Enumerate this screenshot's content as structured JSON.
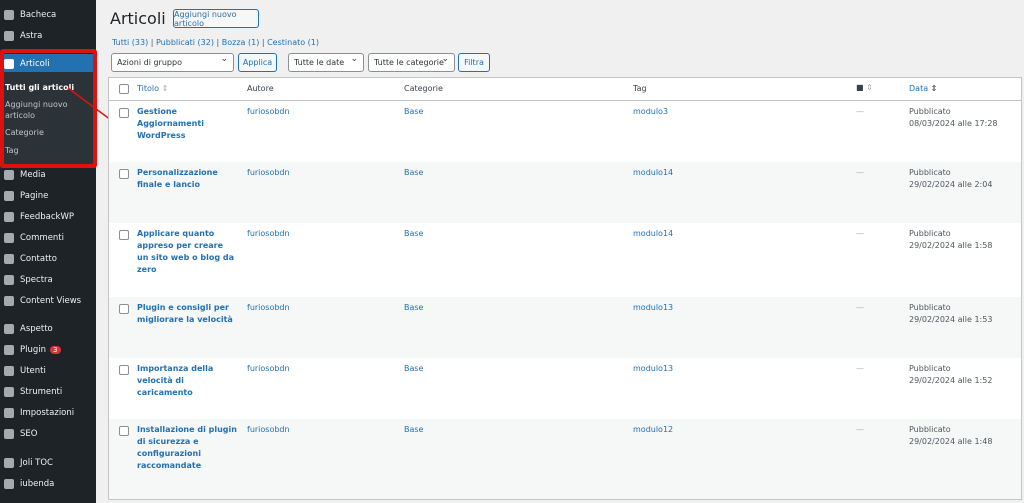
{
  "sidebar": {
    "items": [
      {
        "label": "Bacheca",
        "icon": "dashboard-icon"
      },
      {
        "label": "Astra",
        "icon": "astra-icon"
      },
      {
        "label": "Articoli",
        "icon": "pin-icon"
      },
      {
        "label": "Media",
        "icon": "media-icon"
      },
      {
        "label": "Pagine",
        "icon": "pages-icon"
      },
      {
        "label": "FeedbackWP",
        "icon": "thumbs-up-icon"
      },
      {
        "label": "Commenti",
        "icon": "comment-icon"
      },
      {
        "label": "Contatto",
        "icon": "mail-icon"
      },
      {
        "label": "Spectra",
        "icon": "spectra-icon"
      },
      {
        "label": "Content Views",
        "icon": "grid-icon"
      },
      {
        "label": "Aspetto",
        "icon": "brush-icon"
      },
      {
        "label": "Plugin",
        "icon": "plugin-icon",
        "badge": "3"
      },
      {
        "label": "Utenti",
        "icon": "user-icon"
      },
      {
        "label": "Strumenti",
        "icon": "wrench-icon"
      },
      {
        "label": "Impostazioni",
        "icon": "settings-icon"
      },
      {
        "label": "SEO",
        "icon": "seo-icon"
      },
      {
        "label": "Joli TOC",
        "icon": "drop-icon"
      },
      {
        "label": "iubenda",
        "icon": "iubenda-icon"
      }
    ],
    "submenu": [
      "Tutti gli articoli",
      "Aggiungi nuovo articolo",
      "Categorie",
      "Tag"
    ]
  },
  "page": {
    "title": "Articoli",
    "add_new": "Aggiungi nuovo articolo"
  },
  "views": {
    "all": "Tutti (33)",
    "published": "Pubblicati (32)",
    "draft": "Bozza (1)",
    "trash": "Cestinato (1)"
  },
  "filters": {
    "bulk": "Azioni di gruppo",
    "apply": "Applica",
    "dates": "Tutte le date",
    "cats": "Tutte le categorie",
    "filter": "Filtra"
  },
  "table": {
    "headers": {
      "title": "Titolo",
      "author": "Autore",
      "categories": "Categorie",
      "tag": "Tag",
      "date": "Data"
    },
    "rows": [
      {
        "title": "Gestione Aggiornamenti WordPress",
        "author": "furiosobdn",
        "category": "Base",
        "tag": "modulo3",
        "comments": "—",
        "status": "Pubblicato",
        "date": "08/03/2024 alle 17:28"
      },
      {
        "title": "Personalizzazione finale e lancio",
        "author": "furiosobdn",
        "category": "Base",
        "tag": "modulo14",
        "comments": "—",
        "status": "Pubblicato",
        "date": "29/02/2024 alle 2:04"
      },
      {
        "title": "Applicare quanto appreso per creare un sito web o blog da zero",
        "author": "furiosobdn",
        "category": "Base",
        "tag": "modulo14",
        "comments": "—",
        "status": "Pubblicato",
        "date": "29/02/2024 alle 1:58"
      },
      {
        "title": "Plugin e consigli per migliorare la velocità",
        "author": "furiosobdn",
        "category": "Base",
        "tag": "modulo13",
        "comments": "—",
        "status": "Pubblicato",
        "date": "29/02/2024 alle 1:53"
      },
      {
        "title": "Importanza della velocità di caricamento",
        "author": "furiosobdn",
        "category": "Base",
        "tag": "modulo13",
        "comments": "—",
        "status": "Pubblicato",
        "date": "29/02/2024 alle 1:52"
      },
      {
        "title": "Installazione di plugin di sicurezza e configurazioni raccomandate",
        "author": "furiosobdn",
        "category": "Base",
        "tag": "modulo12",
        "comments": "—",
        "status": "Pubblicato",
        "date": "29/02/2024 alle 1:48"
      }
    ]
  }
}
